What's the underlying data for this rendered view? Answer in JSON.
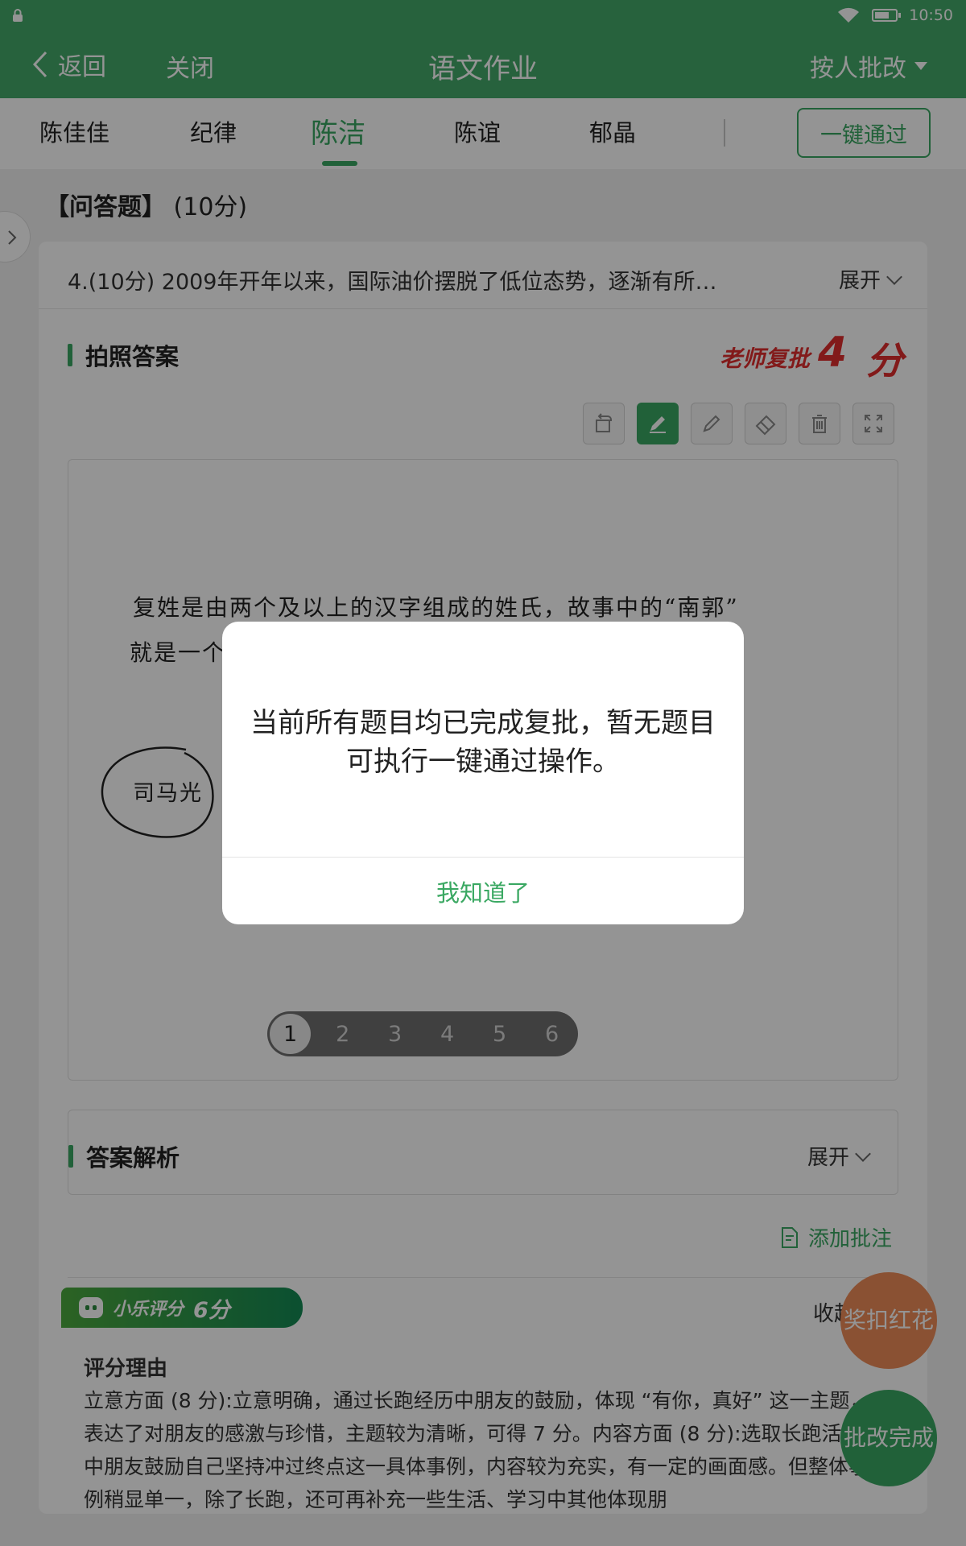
{
  "status_bar": {
    "time": "10:50"
  },
  "nav": {
    "back": "返回",
    "close": "关闭",
    "title": "语文作业",
    "mode": "按人批改"
  },
  "students": {
    "tabs": [
      "陈佳佳",
      "纪律",
      "陈洁",
      "陈谊",
      "郁晶"
    ],
    "active": "陈洁",
    "pass_all": "一键通过"
  },
  "section": {
    "type": "【问答题】",
    "score": "(10分)"
  },
  "question": {
    "text": "4.(10分) 2009年开年以来，国际油价摆脱了低位态势，逐渐有所…",
    "expand": "展开"
  },
  "photo_answer": {
    "title": "拍照答案",
    "review_label": "老师复批",
    "review_score": "4",
    "review_unit": "分",
    "handwriting_line1": "复姓是由两个及以上的汉字组成的姓氏，故事中的“南郭”",
    "handwriting_line2": "就是一个",
    "circled_note": "司马光",
    "tools": [
      "rotate-icon",
      "pen-icon",
      "pencil-icon",
      "eraser-icon",
      "trash-icon",
      "fullscreen-icon"
    ],
    "active_tool": "pen-icon"
  },
  "pager": {
    "pages": [
      "1",
      "2",
      "3",
      "4",
      "5",
      "6"
    ],
    "current": "1"
  },
  "analysis": {
    "title": "答案解析",
    "expand": "展开"
  },
  "add_note": "添加批注",
  "ai": {
    "name": "小乐评分",
    "score": "6分",
    "collapse": "收起",
    "reason_title": "评分理由",
    "reason_text": "立意方面 (8 分):立意明确，通过长跑经历中朋友的鼓励，体现 “有你，真好” 这一主题，表达了对朋友的感激与珍惜，主题较为清晰，可得 7 分。内容方面 (8 分):选取长跑活动中朋友鼓励自己坚持冲过终点这一具体事例，内容较为充实，有一定的画面感。但整体事例稍显单一，除了长跑，还可再补充一些生活、学习中其他体现朋"
  },
  "fab": {
    "flower": "奖扣红花",
    "finish": "批改完成"
  },
  "dialog": {
    "message": "当前所有题目均已完成复批，暂无题目可执行一键通过操作。",
    "confirm": "我知道了"
  },
  "colors": {
    "brand": "#44a96a",
    "accent": "#3aa862",
    "review_red": "#e02d2d",
    "flower": "#ee8c58"
  }
}
